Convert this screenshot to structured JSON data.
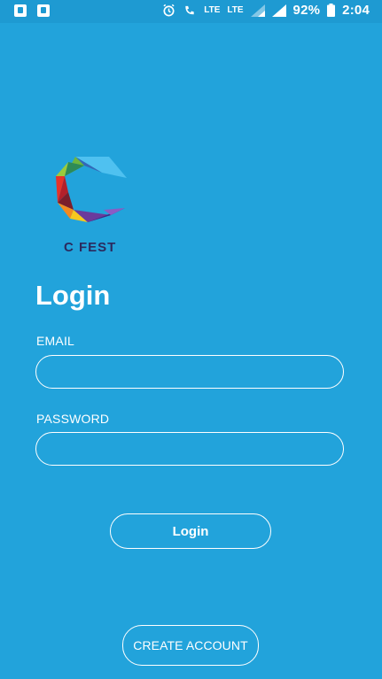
{
  "status_bar": {
    "network_label_1": "LTE",
    "network_label_2": "LTE",
    "battery_percent": "92%",
    "time": "2:04"
  },
  "brand": {
    "name": "C FEST"
  },
  "page": {
    "title": "Login"
  },
  "form": {
    "email_label": "EMAIL",
    "email_value": "",
    "password_label": "PASSWORD",
    "password_value": ""
  },
  "buttons": {
    "login": "Login",
    "create_account": "CREATE ACCOUNT"
  },
  "colors": {
    "background": "#22A3DB",
    "text": "#FFFFFF",
    "brand_text": "#2B2A5E"
  }
}
